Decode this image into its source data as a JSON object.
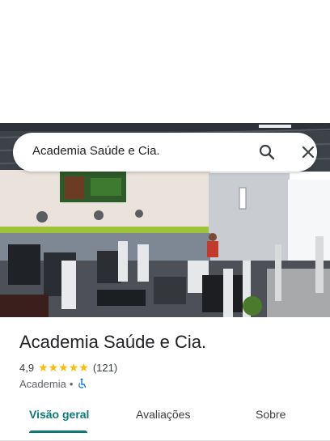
{
  "search": {
    "query": "Academia Saúde e Cia."
  },
  "place": {
    "name": "Academia Saúde e Cia.",
    "rating": "4,9",
    "stars": "★★★★★",
    "review_count": "(121)",
    "category": "Academia",
    "separator": "•",
    "accessibility_icon": "wheelchair-icon"
  },
  "tabs": [
    {
      "label": "Visão geral",
      "active": true
    },
    {
      "label": "Avaliações",
      "active": false
    },
    {
      "label": "Sobre",
      "active": false
    }
  ],
  "colors": {
    "accent": "#0b7a7a",
    "star": "#fbbc04",
    "accessibility": "#1a73e8"
  }
}
